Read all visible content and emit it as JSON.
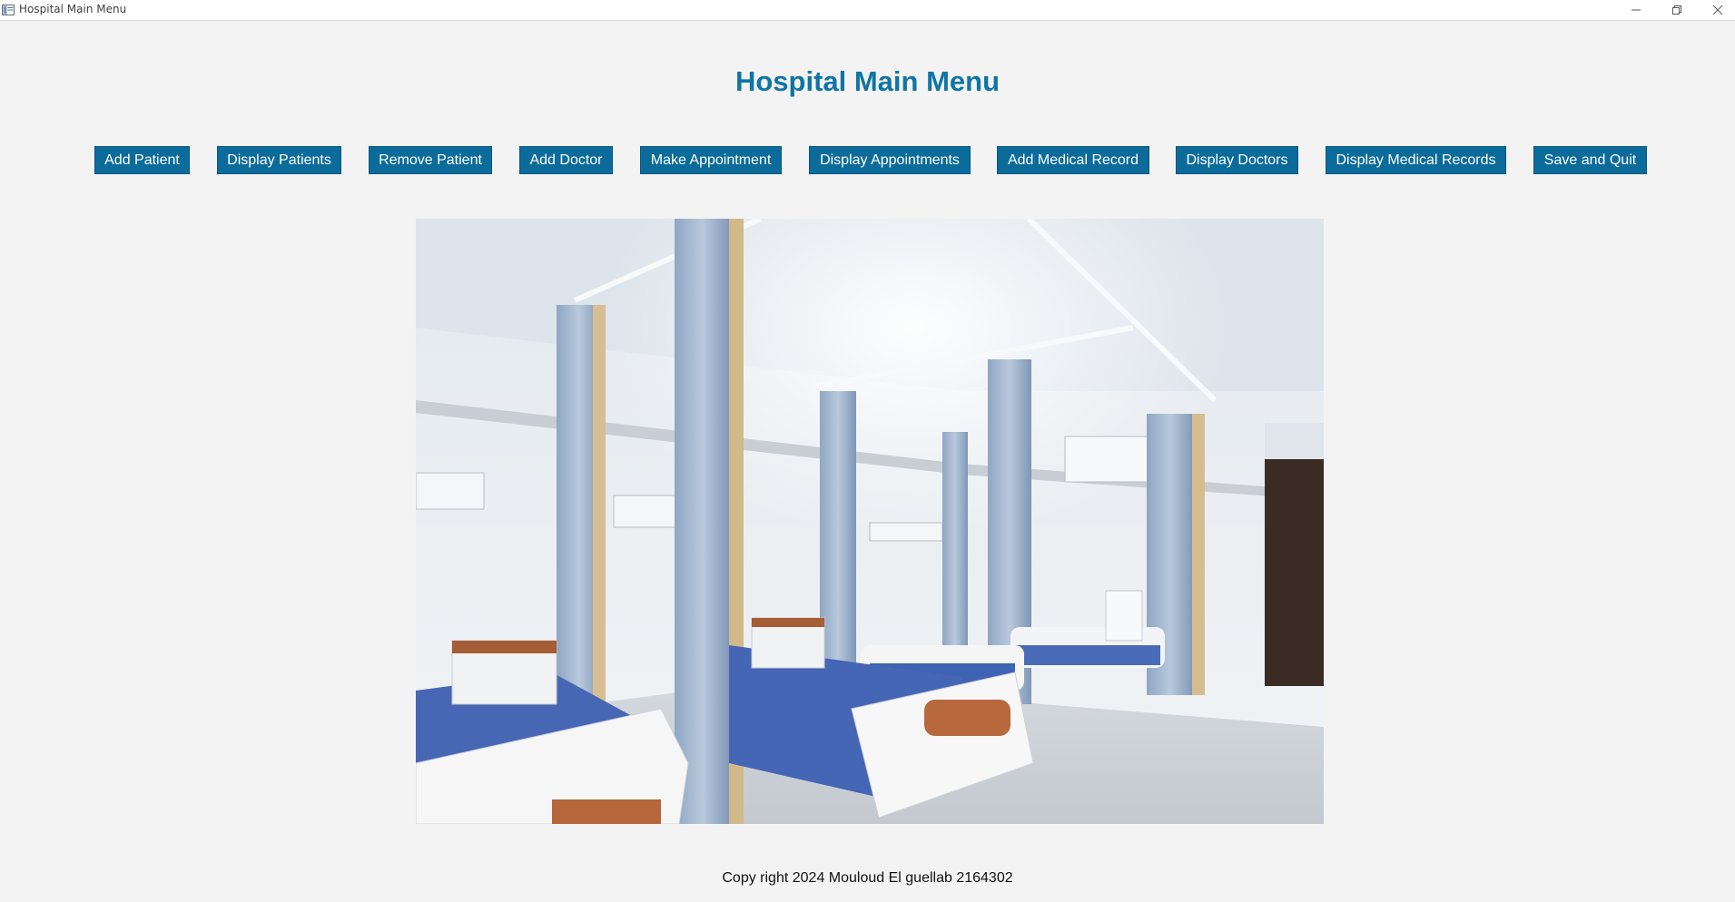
{
  "window": {
    "title": "Hospital Main Menu"
  },
  "header": {
    "title": "Hospital Main Menu"
  },
  "menu": {
    "buttons": [
      {
        "label": "Add Patient"
      },
      {
        "label": "Display Patients"
      },
      {
        "label": "Remove Patient"
      },
      {
        "label": "Add Doctor"
      },
      {
        "label": "Make Appointment"
      },
      {
        "label": "Display Appointments"
      },
      {
        "label": "Add Medical Record"
      },
      {
        "label": "Display Doctors"
      },
      {
        "label": "Display Medical Records"
      },
      {
        "label": "Save and Quit"
      }
    ]
  },
  "footer": {
    "text": "Copy right 2024 Mouloud El guellab 2164302"
  },
  "colors": {
    "title": "#0f75a6",
    "button_bg": "#0b6b9a",
    "button_text": "#ffffff",
    "background": "#f3f3f3"
  },
  "icons": {
    "app": "window-app-icon",
    "minimize": "minimize-icon",
    "maximize": "restore-icon",
    "close": "close-icon"
  }
}
